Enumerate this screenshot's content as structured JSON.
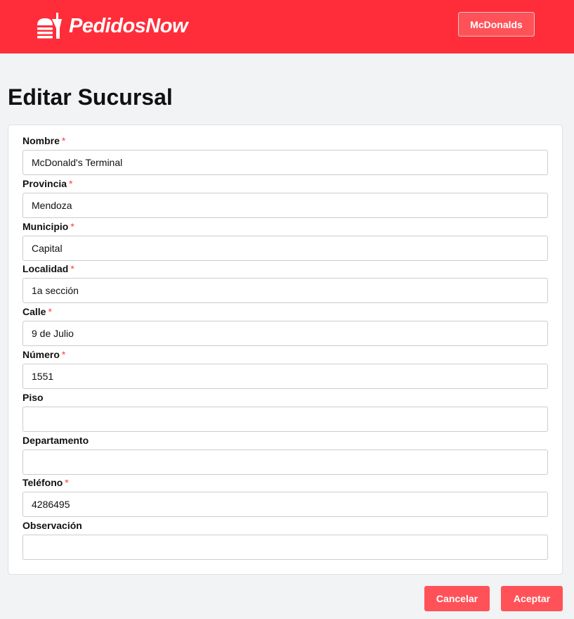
{
  "header": {
    "brand": "PedidosNow",
    "store_button": "McDonalds"
  },
  "page_title": "Editar Sucursal",
  "fields": [
    {
      "label": "Nombre",
      "required": true,
      "value": "McDonald's Terminal"
    },
    {
      "label": "Provincia",
      "required": true,
      "value": "Mendoza"
    },
    {
      "label": "Municipio",
      "required": true,
      "value": "Capital"
    },
    {
      "label": "Localidad",
      "required": true,
      "value": "1a sección"
    },
    {
      "label": "Calle",
      "required": true,
      "value": "9 de Julio"
    },
    {
      "label": "Número",
      "required": true,
      "value": "1551"
    },
    {
      "label": "Piso",
      "required": false,
      "value": ""
    },
    {
      "label": "Departamento",
      "required": false,
      "value": ""
    },
    {
      "label": "Teléfono",
      "required": true,
      "value": "4286495"
    },
    {
      "label": "Observación",
      "required": false,
      "value": ""
    }
  ],
  "required_marker": "*",
  "actions": {
    "cancel": "Cancelar",
    "accept": "Aceptar"
  }
}
